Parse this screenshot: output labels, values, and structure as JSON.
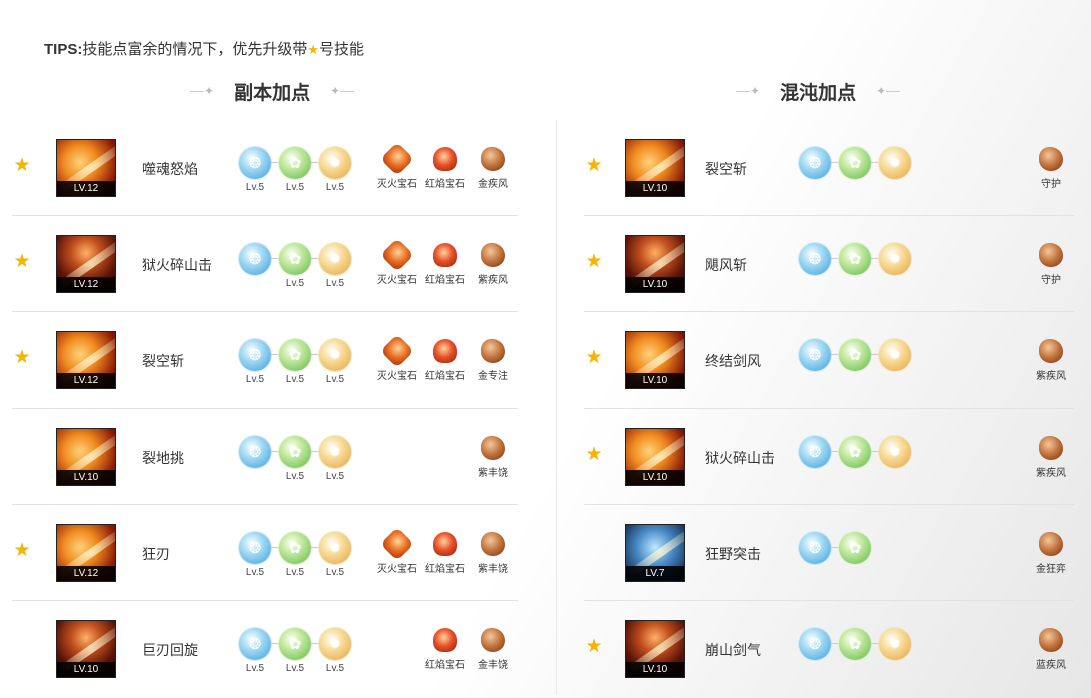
{
  "tips": {
    "label": "TIPS:",
    "text_before": "技能点富余的情况下，优先升级带",
    "text_after": "号技能"
  },
  "left_title": "副本加点",
  "right_title": "混沌加点",
  "left_rows": [
    {
      "starred": true,
      "name": "噬魂怒焰",
      "level": "LV.12",
      "runes": [
        {
          "color": "blue",
          "lv": "Lv.5"
        },
        {
          "color": "green",
          "lv": "Lv.5"
        },
        {
          "color": "gold",
          "lv": "Lv.5"
        }
      ],
      "gems": [
        {
          "type": "fire",
          "name": "灭火宝石"
        },
        {
          "type": "red",
          "name": "红焰宝石"
        },
        {
          "type": "brown",
          "name": "金疾风"
        }
      ]
    },
    {
      "starred": true,
      "name": "狱火碎山击",
      "level": "LV.12",
      "runes": [
        {
          "color": "blue",
          "lv": ""
        },
        {
          "color": "green",
          "lv": "Lv.5"
        },
        {
          "color": "gold",
          "lv": "Lv.5"
        }
      ],
      "gems": [
        {
          "type": "fire",
          "name": "灭火宝石"
        },
        {
          "type": "red",
          "name": "红焰宝石"
        },
        {
          "type": "brown",
          "name": "紫疾风"
        }
      ]
    },
    {
      "starred": true,
      "name": "裂空斩",
      "level": "LV.12",
      "runes": [
        {
          "color": "blue",
          "lv": "Lv.5"
        },
        {
          "color": "green",
          "lv": "Lv.5"
        },
        {
          "color": "gold",
          "lv": "Lv.5"
        }
      ],
      "gems": [
        {
          "type": "fire",
          "name": "灭火宝石"
        },
        {
          "type": "red",
          "name": "红焰宝石"
        },
        {
          "type": "brown",
          "name": "金专注"
        }
      ]
    },
    {
      "starred": false,
      "name": "裂地挑",
      "level": "LV.10",
      "runes": [
        {
          "color": "blue",
          "lv": ""
        },
        {
          "color": "green",
          "lv": "Lv.5"
        },
        {
          "color": "gold",
          "lv": "Lv.5"
        }
      ],
      "gems": [
        {
          "type": "none",
          "name": ""
        },
        {
          "type": "none",
          "name": ""
        },
        {
          "type": "brown",
          "name": "紫丰饶"
        }
      ]
    },
    {
      "starred": true,
      "name": "狂刃",
      "level": "LV.12",
      "runes": [
        {
          "color": "blue",
          "lv": "Lv.5"
        },
        {
          "color": "green",
          "lv": "Lv.5"
        },
        {
          "color": "gold",
          "lv": "Lv.5"
        }
      ],
      "gems": [
        {
          "type": "fire",
          "name": "灭火宝石"
        },
        {
          "type": "red",
          "name": "红焰宝石"
        },
        {
          "type": "brown",
          "name": "紫丰饶"
        }
      ]
    },
    {
      "starred": false,
      "name": "巨刃回旋",
      "level": "LV.10",
      "runes": [
        {
          "color": "blue",
          "lv": "Lv.5"
        },
        {
          "color": "green",
          "lv": "Lv.5"
        },
        {
          "color": "gold",
          "lv": "Lv.5"
        }
      ],
      "gems": [
        {
          "type": "none",
          "name": ""
        },
        {
          "type": "red",
          "name": "红焰宝石"
        },
        {
          "type": "brown",
          "name": "金丰饶"
        }
      ]
    }
  ],
  "right_rows": [
    {
      "starred": true,
      "name": "裂空斩",
      "level": "LV.10",
      "runes": [
        {
          "color": "blue",
          "lv": ""
        },
        {
          "color": "green",
          "lv": ""
        },
        {
          "color": "gold",
          "lv": ""
        }
      ],
      "gems": [
        {
          "type": "brown",
          "name": "守护"
        }
      ]
    },
    {
      "starred": true,
      "name": "飓风斩",
      "level": "LV.10",
      "runes": [
        {
          "color": "blue",
          "lv": ""
        },
        {
          "color": "green",
          "lv": ""
        },
        {
          "color": "gold",
          "lv": ""
        }
      ],
      "gems": [
        {
          "type": "brown",
          "name": "守护"
        }
      ]
    },
    {
      "starred": true,
      "name": "终结剑风",
      "level": "LV.10",
      "runes": [
        {
          "color": "blue",
          "lv": ""
        },
        {
          "color": "green",
          "lv": ""
        },
        {
          "color": "gold",
          "lv": ""
        }
      ],
      "gems": [
        {
          "type": "brown",
          "name": "紫疾风"
        }
      ]
    },
    {
      "starred": true,
      "name": "狱火碎山击",
      "level": "LV.10",
      "runes": [
        {
          "color": "blue",
          "lv": ""
        },
        {
          "color": "green",
          "lv": ""
        },
        {
          "color": "gold",
          "lv": ""
        }
      ],
      "gems": [
        {
          "type": "brown",
          "name": "紫疾风"
        }
      ]
    },
    {
      "starred": false,
      "name": "狂野突击",
      "level": "LV.7",
      "runes": [
        {
          "color": "blue",
          "lv": ""
        },
        {
          "color": "green",
          "lv": ""
        }
      ],
      "gems": [
        {
          "type": "brown",
          "name": "金狂弈"
        }
      ]
    },
    {
      "starred": true,
      "name": "崩山剑气",
      "level": "LV.10",
      "runes": [
        {
          "color": "blue",
          "lv": ""
        },
        {
          "color": "green",
          "lv": ""
        },
        {
          "color": "gold",
          "lv": ""
        }
      ],
      "gems": [
        {
          "type": "brown",
          "name": "蓝疾风"
        }
      ]
    }
  ]
}
